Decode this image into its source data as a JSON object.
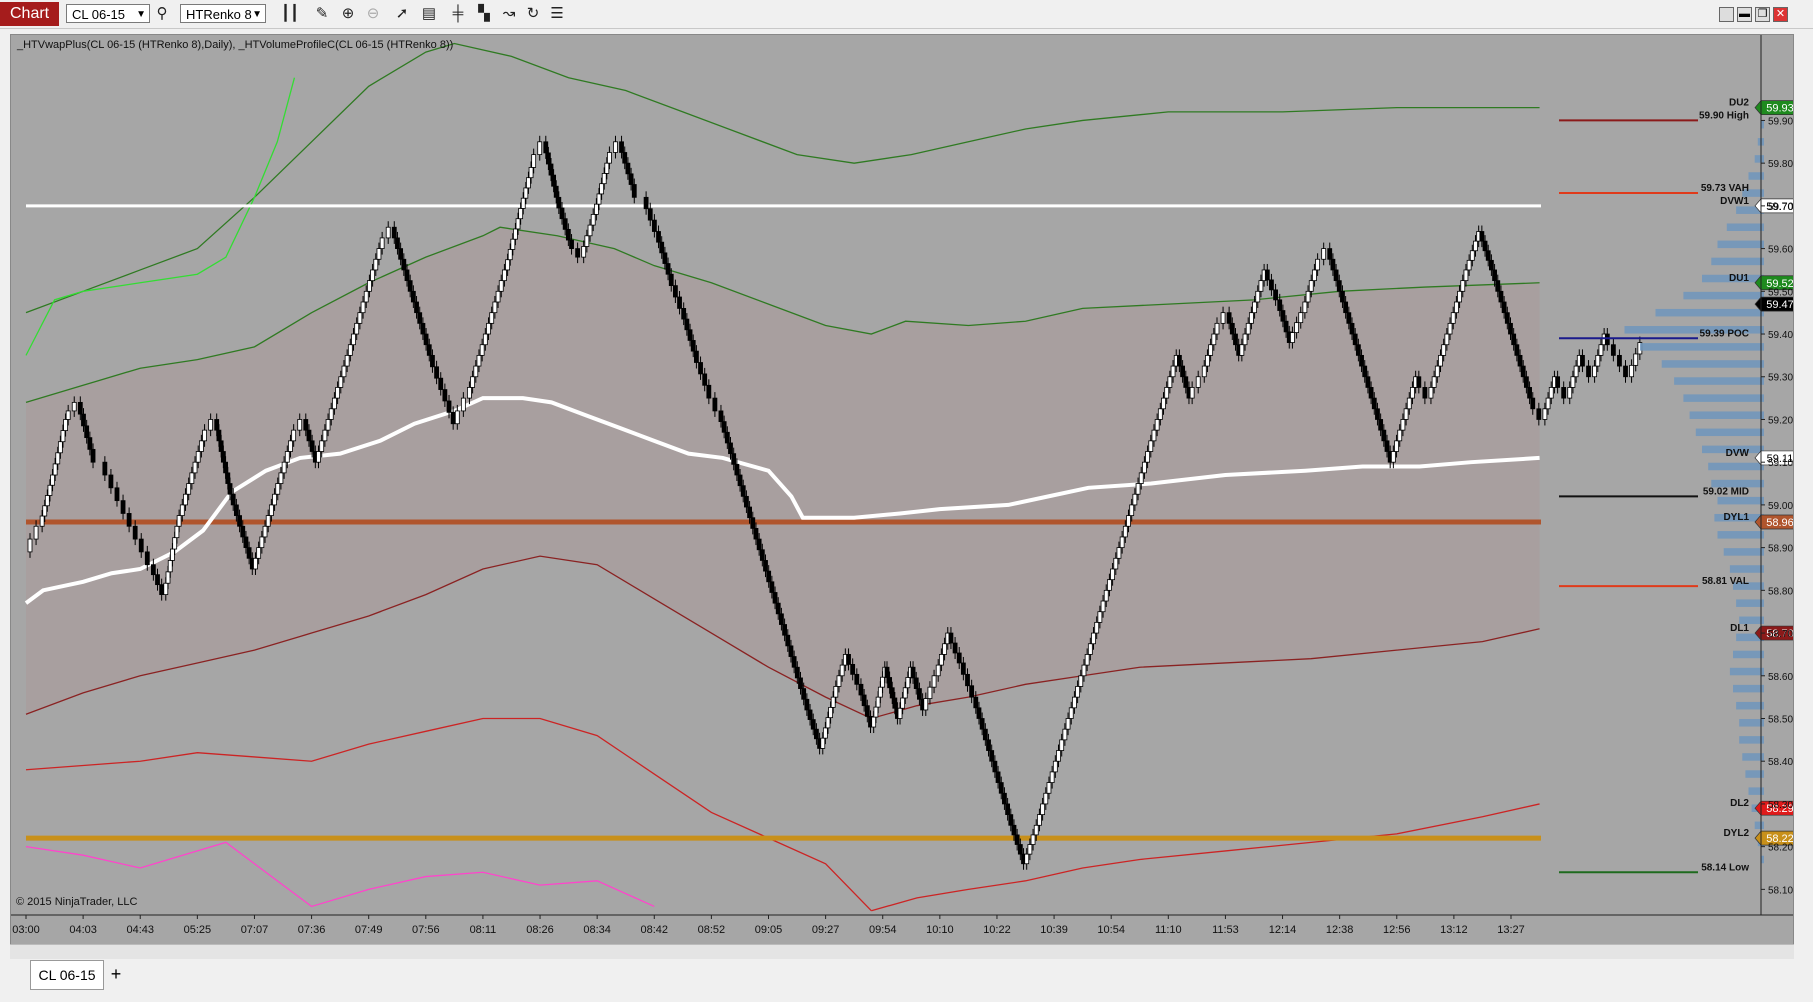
{
  "toolbar": {
    "chart_label": "Chart",
    "instrument": "CL 06-15",
    "bar_type": "HTRenko 8",
    "icons": [
      "bar-type-icon",
      "pencil-icon",
      "zoom-in-icon",
      "zoom-out-icon",
      "pointer-icon",
      "data-box-icon",
      "bars-icon",
      "strategy-icon",
      "indicator-icon",
      "refresh-icon",
      "properties-icon"
    ],
    "window_buttons": [
      "maximize",
      "minimize",
      "restore",
      "close"
    ]
  },
  "bottom": {
    "tab_label": "CL 06-15",
    "add_label": "+"
  },
  "colors": {
    "background": "#a6a6a6",
    "value_area": "#a99e9e",
    "up_bar": "#ffffff",
    "down_bar": "#000000",
    "vwap": "#ffffff",
    "upper_bands": "#2f7a22",
    "upper_band_fast": "#33dd33",
    "lower_bands": "#cc2424",
    "lower_band_dark": "#8a2222",
    "pink_band": "#ff44cc",
    "dyl1": "#b0552d",
    "dyl2": "#c8901a",
    "volume_profile": "#6f95bc"
  },
  "chart_data": {
    "type": "line",
    "title": "_HTVwapPlus(CL 06-15 (HTRenko 8),Daily), _HTVolumeProfileC(CL 06-15 (HTRenko 8))",
    "watermark": "© 2015 NinjaTrader, LLC",
    "x_ticks": [
      "03:00",
      "04:03",
      "04:43",
      "05:25",
      "07:07",
      "07:36",
      "07:49",
      "07:56",
      "08:11",
      "08:26",
      "08:34",
      "08:42",
      "08:52",
      "09:05",
      "09:27",
      "09:54",
      "10:10",
      "10:22",
      "10:39",
      "10:54",
      "11:10",
      "11:53",
      "12:14",
      "12:38",
      "12:56",
      "13:12",
      "13:27"
    ],
    "y_ticks": [
      59.9,
      59.8,
      59.7,
      59.6,
      59.5,
      59.4,
      59.3,
      59.2,
      59.1,
      59.0,
      58.9,
      58.8,
      58.7,
      58.6,
      58.5,
      58.4,
      58.3,
      58.2,
      58.1
    ],
    "ylim": [
      58.04,
      60.1
    ],
    "y_tick_labels": [
      "59.90",
      "59.80",
      "59.70",
      "59.60",
      "59.50",
      "59.40",
      "59.30",
      "59.20",
      "59.10",
      "59.00",
      "58.90",
      "58.80",
      "58.70",
      "58.60",
      "58.50",
      "58.40",
      "58.30",
      "58.20",
      "58.10"
    ],
    "price_path": [
      58.89,
      58.95,
      59.07,
      59.2,
      59.24,
      59.13,
      59.1,
      59.04,
      58.98,
      58.92,
      58.86,
      58.79,
      58.95,
      59.05,
      59.15,
      59.2,
      59.05,
      58.95,
      58.85,
      58.95,
      59.05,
      59.15,
      59.2,
      59.1,
      59.2,
      59.3,
      59.4,
      59.5,
      59.6,
      59.65,
      59.55,
      59.45,
      59.35,
      59.27,
      59.19,
      59.25,
      59.35,
      59.45,
      59.55,
      59.67,
      59.79,
      59.85,
      59.72,
      59.62,
      59.58,
      59.68,
      59.8,
      59.85,
      59.75,
      59.72,
      59.64,
      59.54,
      59.46,
      59.36,
      59.28,
      59.22,
      59.12,
      59.02,
      58.92,
      58.82,
      58.72,
      58.62,
      58.52,
      58.43,
      58.55,
      58.65,
      58.58,
      58.48,
      58.62,
      58.5,
      58.62,
      58.52,
      58.6,
      58.7,
      58.63,
      58.55,
      58.45,
      58.35,
      58.25,
      58.16,
      58.25,
      58.35,
      58.45,
      58.55,
      58.65,
      58.75,
      58.85,
      58.95,
      59.05,
      59.15,
      59.25,
      59.35,
      59.25,
      59.3,
      59.4,
      59.45,
      59.35,
      59.45,
      59.55,
      59.48,
      59.38,
      59.45,
      59.55,
      59.6,
      59.5,
      59.4,
      59.3,
      59.2,
      59.1,
      59.2,
      59.3,
      59.25,
      59.35,
      59.45,
      59.55,
      59.64,
      59.55,
      59.45,
      59.35,
      59.25,
      59.2,
      59.3,
      59.25,
      59.35,
      59.3,
      59.4,
      59.35,
      59.3,
      59.38
    ],
    "vwap_line": [
      [
        0,
        58.77
      ],
      [
        0.3,
        58.8
      ],
      [
        1.0,
        58.82
      ],
      [
        1.5,
        58.84
      ],
      [
        2.0,
        58.85
      ],
      [
        2.6,
        58.89
      ],
      [
        3.1,
        58.94
      ],
      [
        3.6,
        59.03
      ],
      [
        4.2,
        59.08
      ],
      [
        4.8,
        59.11
      ],
      [
        5.5,
        59.12
      ],
      [
        6.2,
        59.15
      ],
      [
        6.8,
        59.19
      ],
      [
        7.5,
        59.22
      ],
      [
        8.0,
        59.25
      ],
      [
        8.7,
        59.25
      ],
      [
        9.2,
        59.24
      ],
      [
        9.8,
        59.21
      ],
      [
        10.4,
        59.18
      ],
      [
        11.0,
        59.15
      ],
      [
        11.6,
        59.12
      ],
      [
        12.2,
        59.11
      ],
      [
        13.0,
        59.08
      ],
      [
        13.4,
        59.02
      ],
      [
        13.6,
        58.97
      ],
      [
        14.5,
        58.97
      ],
      [
        15.3,
        58.98
      ],
      [
        16.0,
        58.99
      ],
      [
        17.2,
        59.0
      ],
      [
        17.9,
        59.02
      ],
      [
        18.6,
        59.04
      ],
      [
        19.7,
        59.05
      ],
      [
        21.0,
        59.07
      ],
      [
        22.4,
        59.08
      ],
      [
        23.4,
        59.09
      ],
      [
        24.4,
        59.09
      ],
      [
        25.3,
        59.1
      ],
      [
        26.5,
        59.11
      ]
    ],
    "upper_band_1": [
      [
        0,
        59.24
      ],
      [
        1,
        59.28
      ],
      [
        2,
        59.32
      ],
      [
        3,
        59.34
      ],
      [
        4,
        59.37
      ],
      [
        5,
        59.45
      ],
      [
        6,
        59.52
      ],
      [
        7,
        59.58
      ],
      [
        8,
        59.63
      ],
      [
        8.3,
        59.65
      ],
      [
        9.3,
        59.63
      ],
      [
        10.3,
        59.6
      ],
      [
        11.0,
        59.56
      ],
      [
        12.0,
        59.52
      ],
      [
        13.0,
        59.47
      ],
      [
        14.0,
        59.42
      ],
      [
        14.8,
        59.4
      ],
      [
        15.4,
        59.43
      ],
      [
        16.5,
        59.42
      ],
      [
        17.5,
        59.43
      ],
      [
        18.5,
        59.46
      ],
      [
        20.0,
        59.47
      ],
      [
        21.5,
        59.48
      ],
      [
        23.0,
        59.5
      ],
      [
        24.5,
        59.51
      ],
      [
        26.5,
        59.52
      ]
    ],
    "upper_band_2": [
      [
        0,
        59.45
      ],
      [
        1,
        59.5
      ],
      [
        2,
        59.55
      ],
      [
        3,
        59.6
      ],
      [
        4,
        59.72
      ],
      [
        5,
        59.85
      ],
      [
        6,
        59.98
      ],
      [
        7,
        60.06
      ],
      [
        7.5,
        60.08
      ],
      [
        8.5,
        60.05
      ],
      [
        9.5,
        60.0
      ],
      [
        10.5,
        59.97
      ],
      [
        11.5,
        59.92
      ],
      [
        12.5,
        59.87
      ],
      [
        13.5,
        59.82
      ],
      [
        14.5,
        59.8
      ],
      [
        15.5,
        59.82
      ],
      [
        16.5,
        59.85
      ],
      [
        17.5,
        59.88
      ],
      [
        18.5,
        59.9
      ],
      [
        20.0,
        59.92
      ],
      [
        22.0,
        59.92
      ],
      [
        24.0,
        59.93
      ],
      [
        26.5,
        59.93
      ]
    ],
    "upper_band_fast": [
      [
        0,
        59.35
      ],
      [
        0.5,
        59.48
      ],
      [
        1.0,
        59.5
      ],
      [
        2.0,
        59.52
      ],
      [
        3.0,
        59.54
      ],
      [
        3.5,
        59.58
      ],
      [
        4.0,
        59.72
      ],
      [
        4.4,
        59.85
      ],
      [
        4.7,
        60.0
      ]
    ],
    "lower_band_1": [
      [
        0,
        58.51
      ],
      [
        1,
        58.56
      ],
      [
        2,
        58.6
      ],
      [
        3,
        58.63
      ],
      [
        4,
        58.66
      ],
      [
        5,
        58.7
      ],
      [
        6,
        58.74
      ],
      [
        7,
        58.79
      ],
      [
        8,
        58.85
      ],
      [
        9,
        58.88
      ],
      [
        10,
        58.86
      ],
      [
        11,
        58.78
      ],
      [
        12,
        58.7
      ],
      [
        13,
        58.62
      ],
      [
        14,
        58.55
      ],
      [
        14.8,
        58.5
      ],
      [
        15.6,
        58.53
      ],
      [
        16.5,
        58.55
      ],
      [
        17.5,
        58.58
      ],
      [
        18.5,
        58.6
      ],
      [
        19.5,
        58.62
      ],
      [
        21.0,
        58.63
      ],
      [
        22.5,
        58.64
      ],
      [
        24.0,
        58.66
      ],
      [
        25.5,
        58.68
      ],
      [
        26.5,
        58.71
      ]
    ],
    "lower_band_2": [
      [
        0,
        58.38
      ],
      [
        1,
        58.39
      ],
      [
        2,
        58.4
      ],
      [
        3,
        58.42
      ],
      [
        4,
        58.41
      ],
      [
        5,
        58.4
      ],
      [
        6,
        58.44
      ],
      [
        7,
        58.47
      ],
      [
        8,
        58.5
      ],
      [
        9,
        58.5
      ],
      [
        10,
        58.46
      ],
      [
        11,
        58.37
      ],
      [
        12,
        58.28
      ],
      [
        13,
        58.22
      ],
      [
        14,
        58.16
      ],
      [
        14.8,
        58.05
      ]
    ],
    "lower_band_3": [
      [
        14.8,
        58.05
      ],
      [
        15.6,
        58.08
      ],
      [
        16.5,
        58.1
      ],
      [
        17.5,
        58.12
      ],
      [
        18.5,
        58.15
      ],
      [
        19.5,
        58.17
      ],
      [
        21.0,
        58.19
      ],
      [
        22.5,
        58.21
      ],
      [
        24.0,
        58.23
      ],
      [
        25.5,
        58.27
      ],
      [
        26.5,
        58.3
      ]
    ],
    "pink_band": [
      [
        0,
        58.2
      ],
      [
        1,
        58.18
      ],
      [
        2,
        58.15
      ],
      [
        3,
        58.19
      ],
      [
        3.5,
        58.21
      ],
      [
        4,
        58.16
      ],
      [
        5,
        58.06
      ],
      [
        6,
        58.1
      ],
      [
        7,
        58.13
      ],
      [
        8,
        58.14
      ],
      [
        9,
        58.11
      ],
      [
        10,
        58.12
      ],
      [
        11.0,
        58.06
      ]
    ],
    "price_lines": [
      {
        "label": "DU2",
        "value": 59.93,
        "color": "#1e8a1e",
        "badge": "59.93",
        "badge_color": "#1e8a1e"
      },
      {
        "label": "59.90 High",
        "value": 59.9,
        "color": "#8b1a1a",
        "line": true
      },
      {
        "label": "59.73 VAH",
        "value": 59.73,
        "color": "#e03a1a",
        "line": true
      },
      {
        "label": "DVW1",
        "value": 59.7,
        "color": "#ffffff",
        "badge": "59.70",
        "badge_color": "#ffffff",
        "hline": true
      },
      {
        "label": "DU1",
        "value": 59.52,
        "color": "#1e8a1e",
        "badge": "59.52",
        "badge_color": "#1e8a1e"
      },
      {
        "label": "",
        "value": 59.47,
        "color": "#000000",
        "badge": "59.47",
        "badge_color": "#000000"
      },
      {
        "label": "59.39 POC",
        "value": 59.39,
        "color": "#1a1a8c",
        "line": true
      },
      {
        "label": "DVW",
        "value": 59.11,
        "color": "#ffffff",
        "badge": "59.11",
        "badge_color": "#ffffff"
      },
      {
        "label": "59.02 MID",
        "value": 59.02,
        "color": "#111111",
        "line": true
      },
      {
        "label": "DYL1",
        "value": 58.96,
        "color": "#b0552d",
        "badge": "58.96",
        "badge_color": "#b0552d",
        "hline": true
      },
      {
        "label": "58.81 VAL",
        "value": 58.81,
        "color": "#e03a1a",
        "line": true
      },
      {
        "label": "DL1",
        "value": 58.7,
        "color": "#8b1a1a",
        "badge": "58.70",
        "badge_color": "#8b1a1a"
      },
      {
        "label": "DL2",
        "value": 58.29,
        "color": "#e01a1a",
        "badge": "58.29",
        "badge_color": "#e01a1a"
      },
      {
        "label": "DYL2",
        "value": 58.22,
        "color": "#c8901a",
        "badge": "58.22",
        "badge_color": "#c8901a",
        "hline": true
      },
      {
        "label": "58.14 Low",
        "value": 58.14,
        "color": "#1e6a1e",
        "line": true
      }
    ],
    "volume_profile": [
      [
        59.88,
        2
      ],
      [
        59.84,
        4
      ],
      [
        59.8,
        6
      ],
      [
        59.76,
        10
      ],
      [
        59.72,
        14
      ],
      [
        59.68,
        18
      ],
      [
        59.64,
        24
      ],
      [
        59.6,
        30
      ],
      [
        59.56,
        34
      ],
      [
        59.52,
        40
      ],
      [
        59.48,
        52
      ],
      [
        59.44,
        70
      ],
      [
        59.4,
        90
      ],
      [
        59.36,
        80
      ],
      [
        59.32,
        66
      ],
      [
        59.28,
        58
      ],
      [
        59.24,
        52
      ],
      [
        59.2,
        48
      ],
      [
        59.16,
        44
      ],
      [
        59.12,
        40
      ],
      [
        59.08,
        36
      ],
      [
        59.04,
        34
      ],
      [
        59.0,
        30
      ],
      [
        58.96,
        32
      ],
      [
        58.92,
        30
      ],
      [
        58.88,
        26
      ],
      [
        58.84,
        22
      ],
      [
        58.8,
        20
      ],
      [
        58.76,
        18
      ],
      [
        58.72,
        16
      ],
      [
        58.68,
        18
      ],
      [
        58.64,
        20
      ],
      [
        58.6,
        22
      ],
      [
        58.56,
        20
      ],
      [
        58.52,
        18
      ],
      [
        58.48,
        16
      ],
      [
        58.44,
        16
      ],
      [
        58.4,
        14
      ],
      [
        58.36,
        12
      ],
      [
        58.32,
        10
      ],
      [
        58.28,
        8
      ],
      [
        58.24,
        6
      ],
      [
        58.2,
        4
      ],
      [
        58.16,
        2
      ]
    ]
  }
}
